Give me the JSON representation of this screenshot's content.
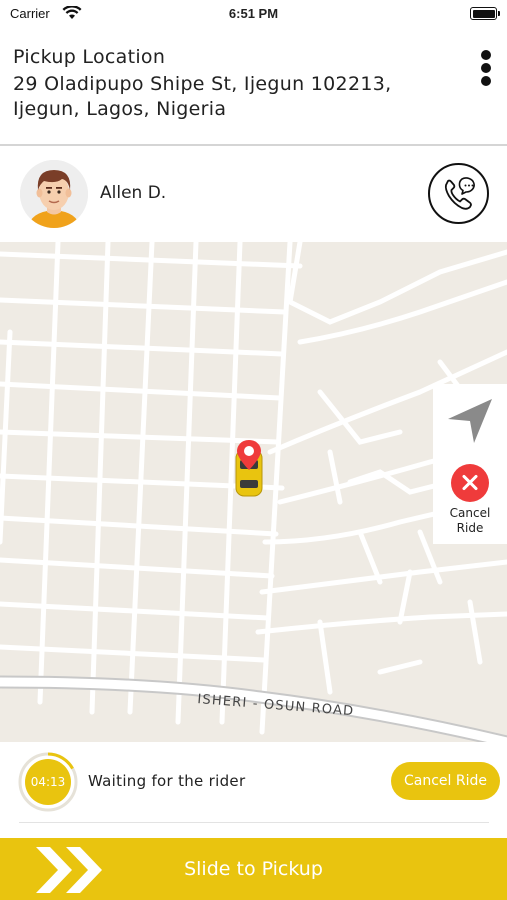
{
  "status_bar": {
    "carrier": "Carrier",
    "time": "6:51 PM"
  },
  "pickup": {
    "title": "Pickup Location",
    "address": "29 Oladipupo Shipe St, Ijegun 102213, Ijegun, Lagos, Nigeria",
    "menu_icon": "more-vertical-icon"
  },
  "driver": {
    "name": "Allen D.",
    "avatar_icon": "user-avatar",
    "call_icon": "phone-chat-icon"
  },
  "map": {
    "road_label": "ISHERI - OSUN ROAD",
    "marker_icon": "pin-icon",
    "vehicle_icon": "taxi-car-icon",
    "locate_icon": "navigation-arrow-icon",
    "cancel_label": "Cancel Ride",
    "cancel_icon": "close-circle-icon"
  },
  "waiting": {
    "timer": "04:13",
    "timer_progress": 0.17,
    "status_text": "Waiting for the rider",
    "cancel_button": "Cancel Ride"
  },
  "slide": {
    "label": "Slide to Pickup",
    "chevron_icon": "double-chevron-right-icon"
  },
  "colors": {
    "accent": "#e9c40f",
    "danger": "#ef3b3b",
    "map_bg": "#efebe4",
    "map_road": "#ffffff"
  }
}
